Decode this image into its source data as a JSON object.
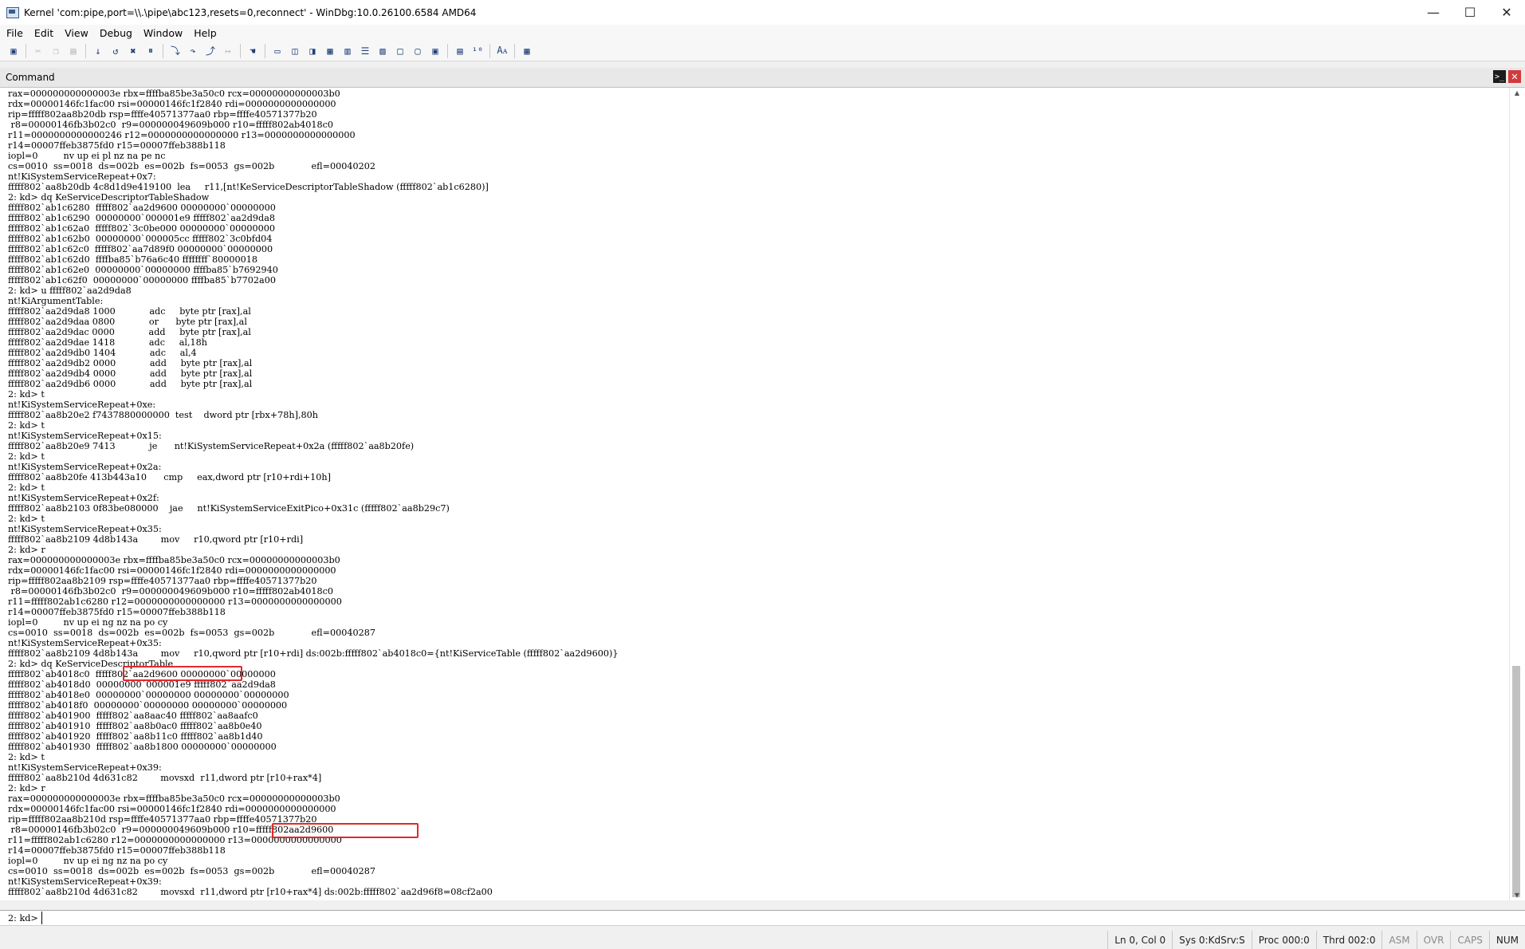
{
  "window": {
    "title": "Kernel 'com:pipe,port=\\\\.\\pipe\\abc123,resets=0,reconnect' - WinDbg:10.0.26100.6584 AMD64",
    "minimize": "—",
    "maximize": "☐",
    "close": "✕"
  },
  "menu": [
    "File",
    "Edit",
    "View",
    "Debug",
    "Window",
    "Help"
  ],
  "toolbar_icons": [
    "open-icon",
    "cut-icon",
    "copy-icon",
    "paste-icon",
    "go-icon",
    "restart-icon",
    "stop-debugging-icon",
    "break-icon",
    "step-into-icon",
    "step-over-icon",
    "step-out-icon",
    "run-to-cursor-icon",
    "source-mode-icon",
    "command-window-icon",
    "watch-window-icon",
    "locals-window-icon",
    "registers-window-icon",
    "memory-window-icon",
    "call-stack-icon",
    "disassembly-icon",
    "scratch-pad-icon",
    "source-mode-on-icon",
    "source-mode-off-icon",
    "font-icon",
    "options-icon"
  ],
  "command_window": {
    "title": "Command",
    "lines": [
      "rax=000000000000003e rbx=ffffba85be3a50c0 rcx=00000000000003b0",
      "rdx=00000146fc1fac00 rsi=00000146fc1f2840 rdi=0000000000000000",
      "rip=fffff802aa8b20db rsp=ffffe40571377aa0 rbp=ffffe40571377b20",
      " r8=00000146fb3b02c0  r9=000000049609b000 r10=fffff802ab4018c0",
      "r11=0000000000000246 r12=0000000000000000 r13=0000000000000000",
      "r14=00007ffeb3875fd0 r15=00007ffeb388b118",
      "iopl=0         nv up ei pl nz na pe nc",
      "cs=0010  ss=0018  ds=002b  es=002b  fs=0053  gs=002b             efl=00040202",
      "nt!KiSystemServiceRepeat+0x7:",
      "fffff802`aa8b20db 4c8d1d9e419100  lea     r11,[nt!KeServiceDescriptorTableShadow (fffff802`ab1c6280)]",
      "2: kd> dq KeServiceDescriptorTableShadow",
      "fffff802`ab1c6280  fffff802`aa2d9600 00000000`00000000",
      "fffff802`ab1c6290  00000000`000001e9 fffff802`aa2d9da8",
      "fffff802`ab1c62a0  fffff802`3c0be000 00000000`00000000",
      "fffff802`ab1c62b0  00000000`000005cc fffff802`3c0bfd04",
      "fffff802`ab1c62c0  fffff802`aa7d89f0 00000000`00000000",
      "fffff802`ab1c62d0  ffffba85`b76a6c40 ffffffff`80000018",
      "fffff802`ab1c62e0  00000000`00000000 ffffba85`b7692940",
      "fffff802`ab1c62f0  00000000`00000000 ffffba85`b7702a00",
      "2: kd> u fffff802`aa2d9da8",
      "nt!KiArgumentTable:",
      "fffff802`aa2d9da8 1000            adc     byte ptr [rax],al",
      "fffff802`aa2d9daa 0800            or      byte ptr [rax],al",
      "fffff802`aa2d9dac 0000            add     byte ptr [rax],al",
      "fffff802`aa2d9dae 1418            adc     al,18h",
      "fffff802`aa2d9db0 1404            adc     al,4",
      "fffff802`aa2d9db2 0000            add     byte ptr [rax],al",
      "fffff802`aa2d9db4 0000            add     byte ptr [rax],al",
      "fffff802`aa2d9db6 0000            add     byte ptr [rax],al",
      "2: kd> t",
      "nt!KiSystemServiceRepeat+0xe:",
      "fffff802`aa8b20e2 f7437880000000  test    dword ptr [rbx+78h],80h",
      "2: kd> t",
      "nt!KiSystemServiceRepeat+0x15:",
      "fffff802`aa8b20e9 7413            je      nt!KiSystemServiceRepeat+0x2a (fffff802`aa8b20fe)",
      "2: kd> t",
      "nt!KiSystemServiceRepeat+0x2a:",
      "fffff802`aa8b20fe 413b443a10      cmp     eax,dword ptr [r10+rdi+10h]",
      "2: kd> t",
      "nt!KiSystemServiceRepeat+0x2f:",
      "fffff802`aa8b2103 0f83be080000    jae     nt!KiSystemServiceExitPico+0x31c (fffff802`aa8b29c7)",
      "2: kd> t",
      "nt!KiSystemServiceRepeat+0x35:",
      "fffff802`aa8b2109 4d8b143a        mov     r10,qword ptr [r10+rdi]",
      "2: kd> r",
      "rax=000000000000003e rbx=ffffba85be3a50c0 rcx=00000000000003b0",
      "rdx=00000146fc1fac00 rsi=00000146fc1f2840 rdi=0000000000000000",
      "rip=fffff802aa8b2109 rsp=ffffe40571377aa0 rbp=ffffe40571377b20",
      " r8=00000146fb3b02c0  r9=000000049609b000 r10=fffff802ab4018c0",
      "r11=fffff802ab1c6280 r12=0000000000000000 r13=0000000000000000",
      "r14=00007ffeb3875fd0 r15=00007ffeb388b118",
      "iopl=0         nv up ei ng nz na po cy",
      "cs=0010  ss=0018  ds=002b  es=002b  fs=0053  gs=002b             efl=00040287",
      "nt!KiSystemServiceRepeat+0x35:",
      "fffff802`aa8b2109 4d8b143a        mov     r10,qword ptr [r10+rdi] ds:002b:fffff802`ab4018c0={nt!KiServiceTable (fffff802`aa2d9600)}",
      "2: kd> dq KeServiceDescriptorTable",
      "fffff802`ab4018c0  fffff802`aa2d9600 00000000`00000000",
      "fffff802`ab4018d0  00000000`000001e9 fffff802`aa2d9da8",
      "fffff802`ab4018e0  00000000`00000000 00000000`00000000",
      "fffff802`ab4018f0  00000000`00000000 00000000`00000000",
      "fffff802`ab401900  fffff802`aa8aac40 fffff802`aa8aafc0",
      "fffff802`ab401910  fffff802`aa8b0ac0 fffff802`aa8b0e40",
      "fffff802`ab401920  fffff802`aa8b11c0 fffff802`aa8b1d40",
      "fffff802`ab401930  fffff802`aa8b1800 00000000`00000000",
      "2: kd> t",
      "nt!KiSystemServiceRepeat+0x39:",
      "fffff802`aa8b210d 4d631c82        movsxd  r11,dword ptr [r10+rax*4]",
      "2: kd> r",
      "rax=000000000000003e rbx=ffffba85be3a50c0 rcx=00000000000003b0",
      "rdx=00000146fc1fac00 rsi=00000146fc1f2840 rdi=0000000000000000",
      "rip=fffff802aa8b210d rsp=ffffe40571377aa0 rbp=ffffe40571377b20",
      " r8=00000146fb3b02c0  r9=000000049609b000 r10=fffff802aa2d9600",
      "r11=fffff802ab1c6280 r12=0000000000000000 r13=0000000000000000",
      "r14=00007ffeb3875fd0 r15=00007ffeb388b118",
      "iopl=0         nv up ei ng nz na po cy",
      "cs=0010  ss=0018  ds=002b  es=002b  fs=0053  gs=002b             efl=00040287",
      "nt!KiSystemServiceRepeat+0x39:",
      "fffff802`aa8b210d 4d631c82        movsxd  r11,dword ptr [r10+rax*4] ds:002b:fffff802`aa2d96f8=08cf2a00"
    ],
    "highlight_color": "#e12a2a"
  },
  "prompt": {
    "label": "2: kd>",
    "value": ""
  },
  "status": [
    "Ln 0, Col 0",
    "Sys 0:KdSrv:S",
    "Proc 000:0",
    "Thrd 002:0",
    "ASM",
    "OVR",
    "CAPS",
    "NUM"
  ]
}
